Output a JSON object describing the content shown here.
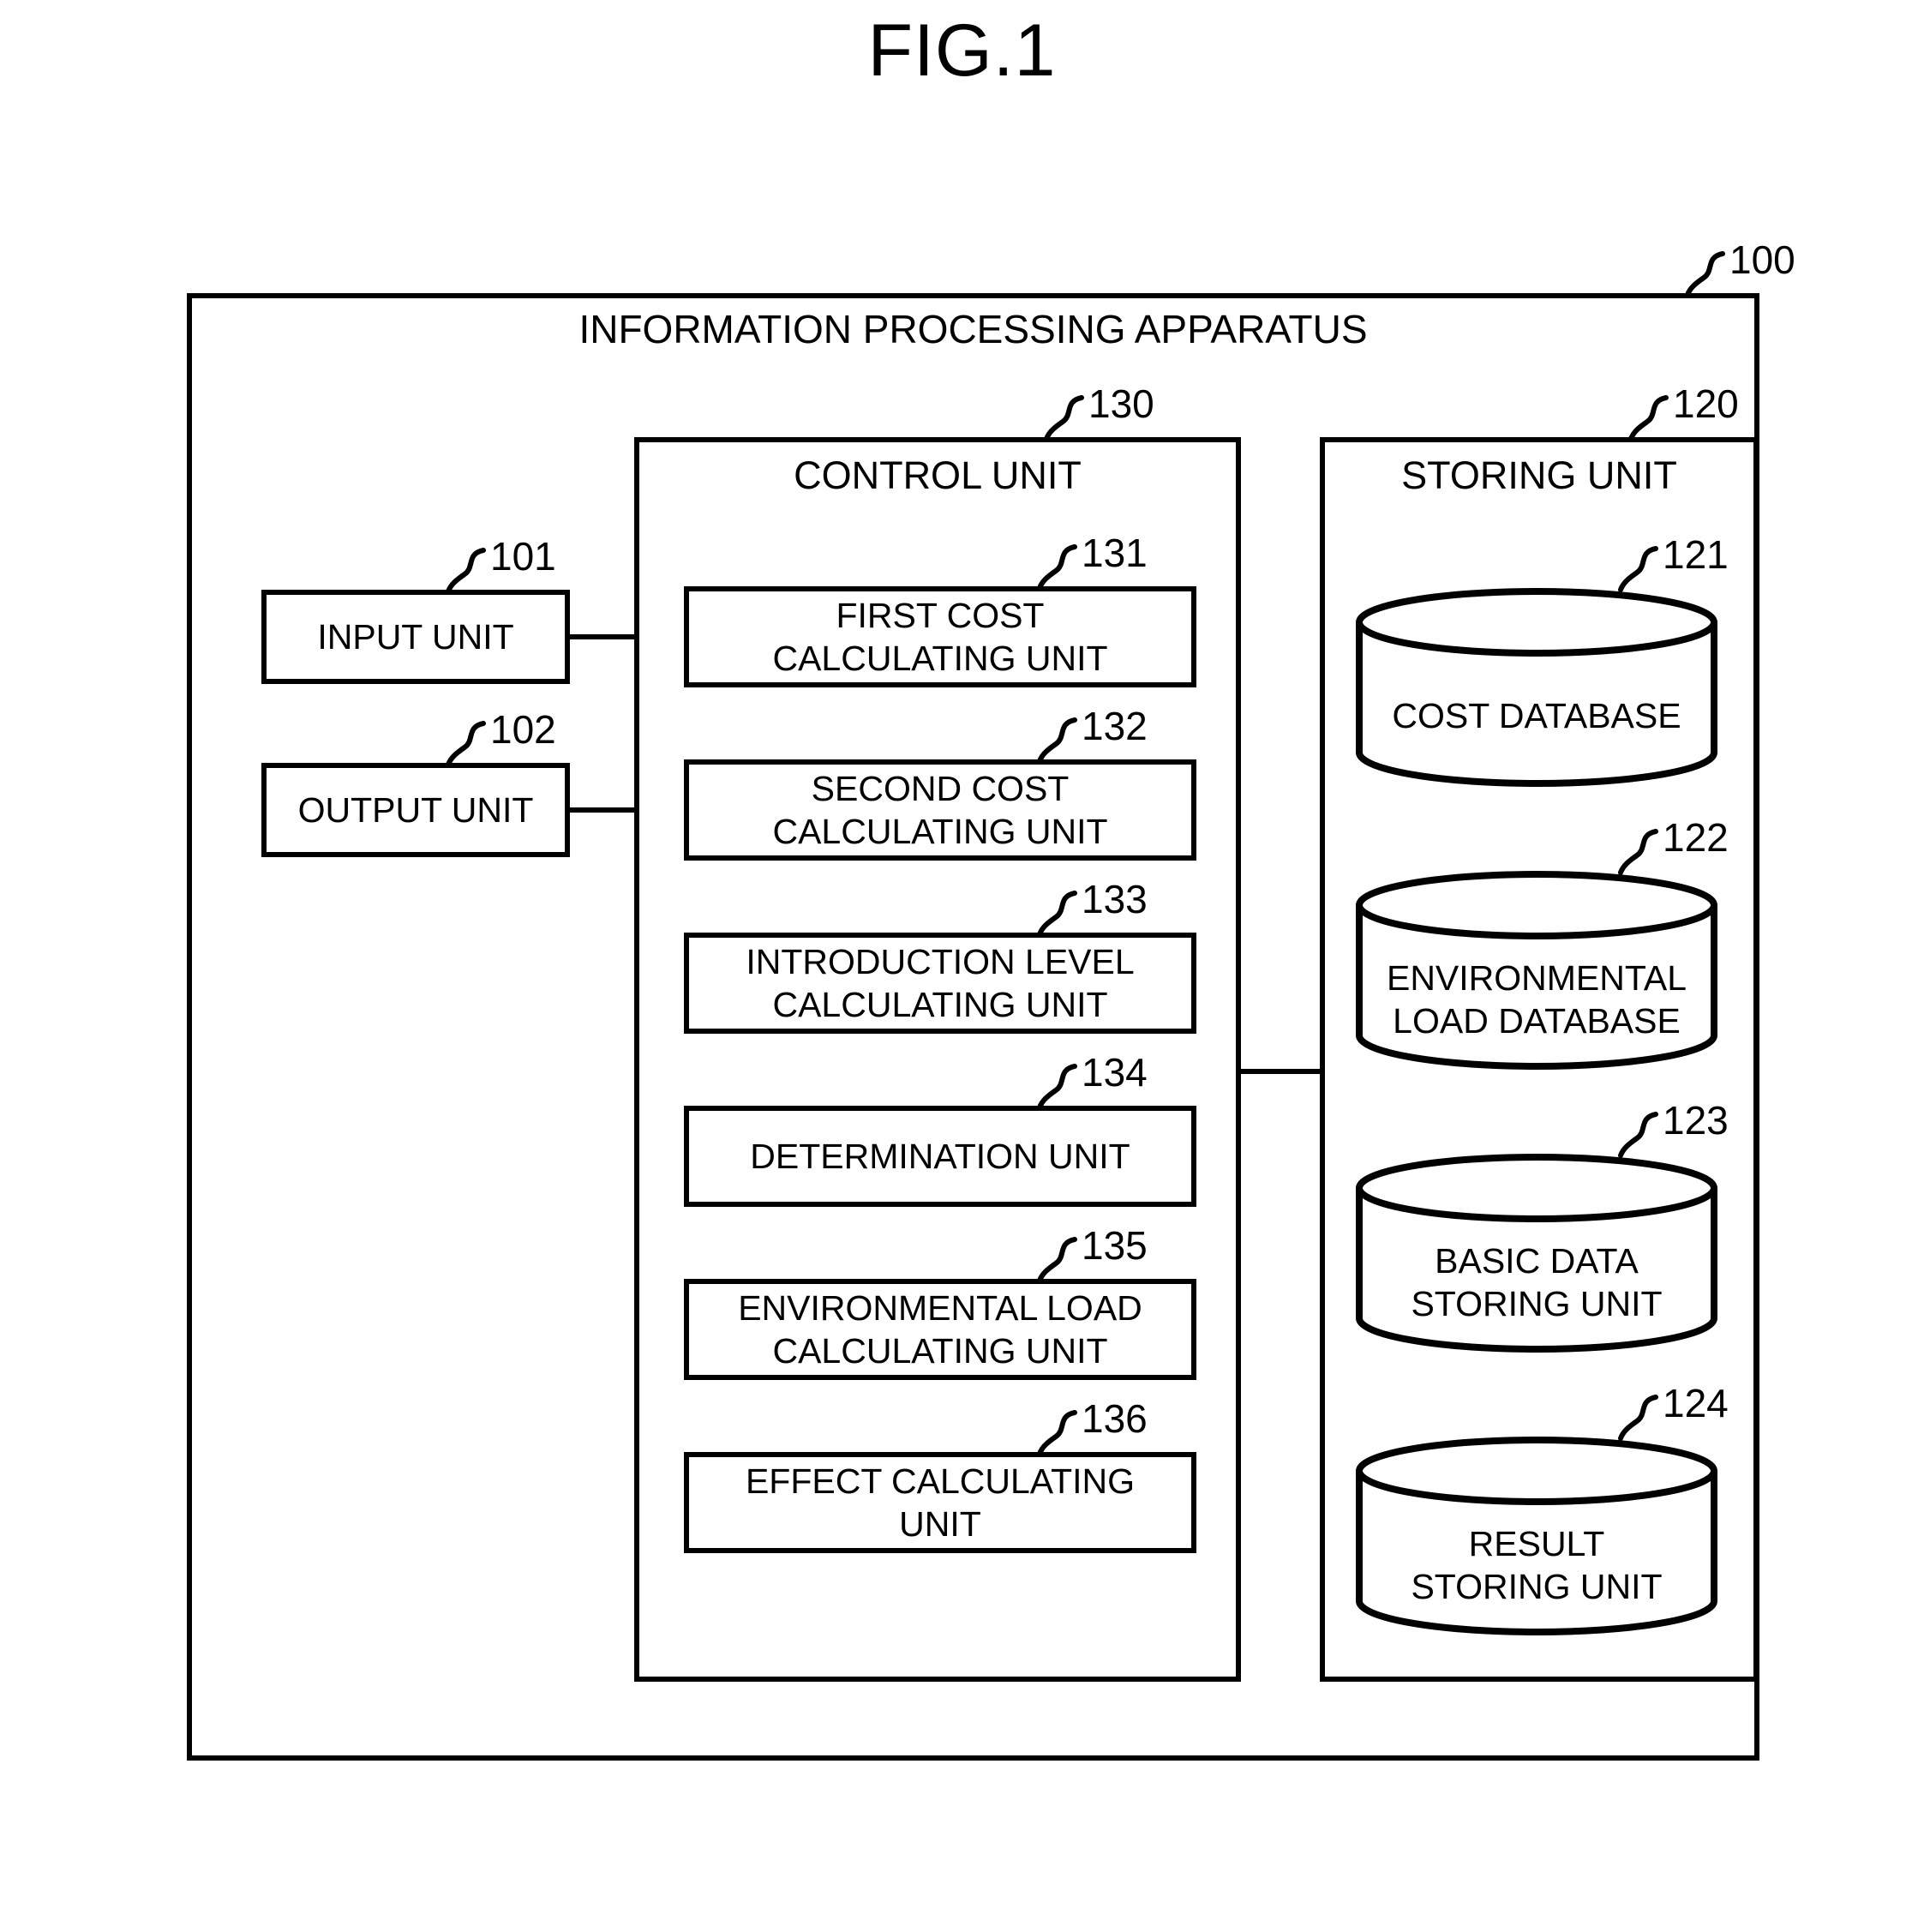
{
  "figure": {
    "title": "FIG.1"
  },
  "apparatus": {
    "label": "INFORMATION PROCESSING APPARATUS",
    "ref": "100"
  },
  "io_units": [
    {
      "label": "INPUT UNIT",
      "ref": "101"
    },
    {
      "label": "OUTPUT UNIT",
      "ref": "102"
    }
  ],
  "control_unit": {
    "label": "CONTROL UNIT",
    "ref": "130",
    "modules": [
      {
        "label": "FIRST COST\nCALCULATING UNIT",
        "ref": "131"
      },
      {
        "label": "SECOND COST\nCALCULATING UNIT",
        "ref": "132"
      },
      {
        "label": "INTRODUCTION LEVEL\nCALCULATING UNIT",
        "ref": "133"
      },
      {
        "label": "DETERMINATION UNIT",
        "ref": "134"
      },
      {
        "label": "ENVIRONMENTAL LOAD\nCALCULATING UNIT",
        "ref": "135"
      },
      {
        "label": "EFFECT CALCULATING\nUNIT",
        "ref": "136"
      }
    ]
  },
  "storing_unit": {
    "label": "STORING UNIT",
    "ref": "120",
    "databases": [
      {
        "label": "COST DATABASE",
        "ref": "121"
      },
      {
        "label": "ENVIRONMENTAL\nLOAD DATABASE",
        "ref": "122"
      },
      {
        "label": "BASIC DATA\nSTORING UNIT",
        "ref": "123"
      },
      {
        "label": "RESULT\nSTORING UNIT",
        "ref": "124"
      }
    ]
  },
  "colors": {
    "line": "#000000",
    "background": "#ffffff"
  }
}
